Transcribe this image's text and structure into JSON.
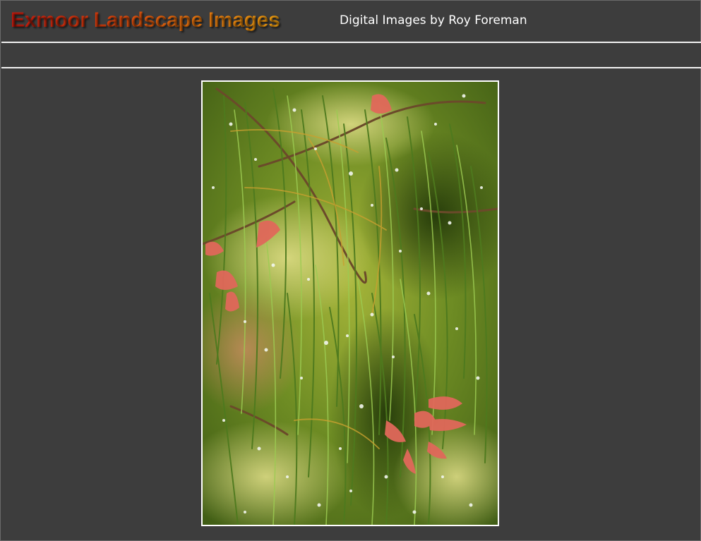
{
  "header": {
    "title": "Exmoor Landscape Images",
    "subtitle": "Digital Images by Roy Foreman"
  },
  "colors": {
    "background": "#3d3d3d",
    "rule": "#f2f2f2",
    "title_gradient_start": "#c41a0e",
    "title_gradient_end": "#f0a010",
    "photo_border": "#ffffff"
  },
  "photo": {
    "icon": "landscape-photo"
  }
}
